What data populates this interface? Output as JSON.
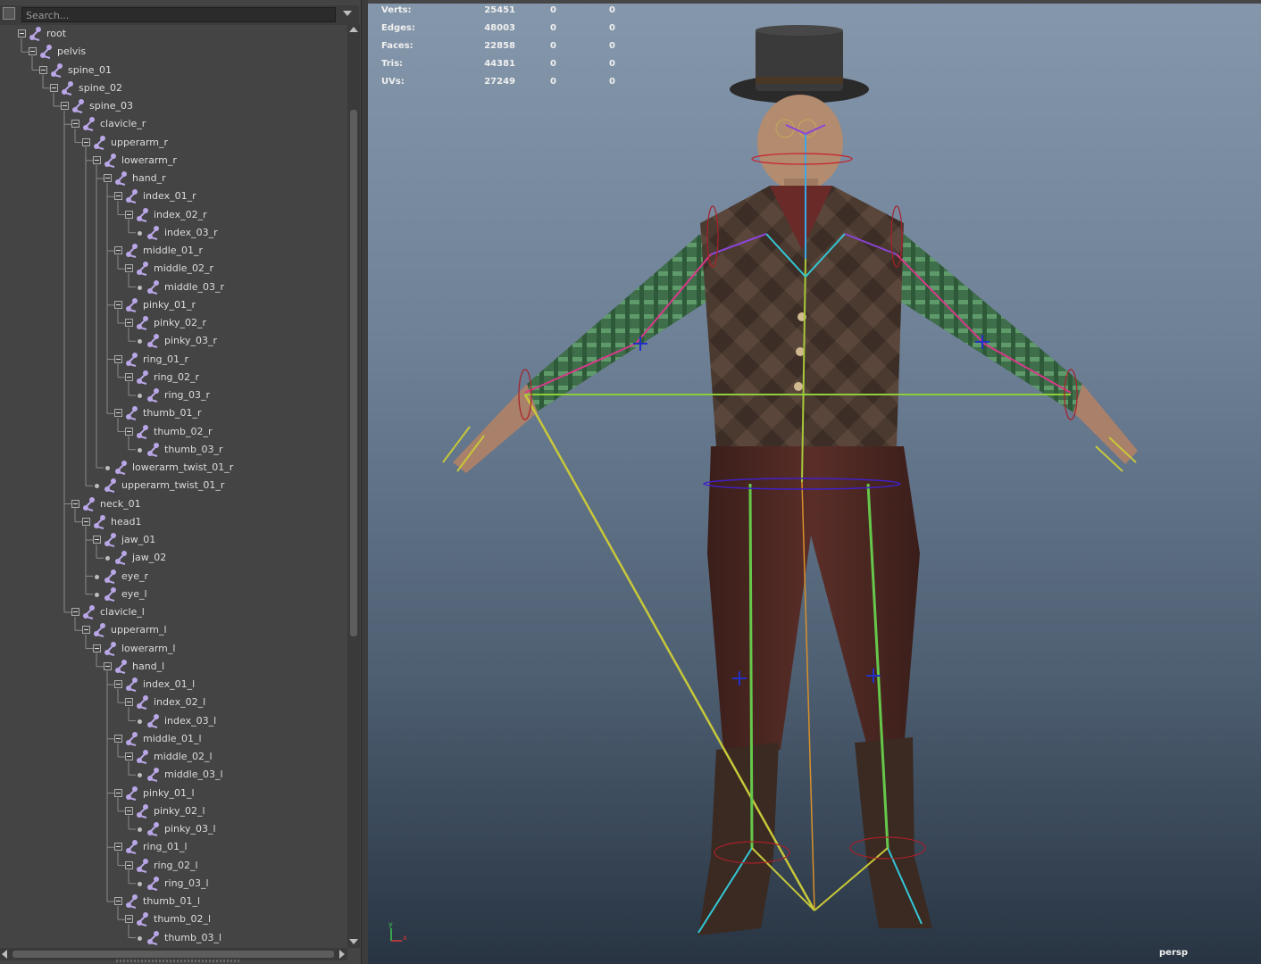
{
  "outliner": {
    "search": {
      "placeholder": "Search..."
    },
    "nodes": [
      {
        "label": "root",
        "depth": 0,
        "expandable": true
      },
      {
        "label": "pelvis",
        "depth": 1,
        "expandable": true
      },
      {
        "label": "spine_01",
        "depth": 2,
        "expandable": true
      },
      {
        "label": "spine_02",
        "depth": 3,
        "expandable": true
      },
      {
        "label": "spine_03",
        "depth": 4,
        "expandable": true
      },
      {
        "label": "clavicle_r",
        "depth": 5,
        "expandable": true
      },
      {
        "label": "upperarm_r",
        "depth": 6,
        "expandable": true
      },
      {
        "label": "lowerarm_r",
        "depth": 7,
        "expandable": true
      },
      {
        "label": "hand_r",
        "depth": 8,
        "expandable": true
      },
      {
        "label": "index_01_r",
        "depth": 9,
        "expandable": true
      },
      {
        "label": "index_02_r",
        "depth": 10,
        "expandable": true
      },
      {
        "label": "index_03_r",
        "depth": 11,
        "expandable": false
      },
      {
        "label": "middle_01_r",
        "depth": 9,
        "expandable": true
      },
      {
        "label": "middle_02_r",
        "depth": 10,
        "expandable": true
      },
      {
        "label": "middle_03_r",
        "depth": 11,
        "expandable": false
      },
      {
        "label": "pinky_01_r",
        "depth": 9,
        "expandable": true
      },
      {
        "label": "pinky_02_r",
        "depth": 10,
        "expandable": true
      },
      {
        "label": "pinky_03_r",
        "depth": 11,
        "expandable": false
      },
      {
        "label": "ring_01_r",
        "depth": 9,
        "expandable": true
      },
      {
        "label": "ring_02_r",
        "depth": 10,
        "expandable": true
      },
      {
        "label": "ring_03_r",
        "depth": 11,
        "expandable": false
      },
      {
        "label": "thumb_01_r",
        "depth": 9,
        "expandable": true
      },
      {
        "label": "thumb_02_r",
        "depth": 10,
        "expandable": true
      },
      {
        "label": "thumb_03_r",
        "depth": 11,
        "expandable": false
      },
      {
        "label": "lowerarm_twist_01_r",
        "depth": 8,
        "expandable": false
      },
      {
        "label": "upperarm_twist_01_r",
        "depth": 7,
        "expandable": false
      },
      {
        "label": "neck_01",
        "depth": 5,
        "expandable": true
      },
      {
        "label": "head1",
        "depth": 6,
        "expandable": true
      },
      {
        "label": "jaw_01",
        "depth": 7,
        "expandable": true
      },
      {
        "label": "jaw_02",
        "depth": 8,
        "expandable": false
      },
      {
        "label": "eye_r",
        "depth": 7,
        "expandable": false
      },
      {
        "label": "eye_l",
        "depth": 7,
        "expandable": false
      },
      {
        "label": "clavicle_l",
        "depth": 5,
        "expandable": true
      },
      {
        "label": "upperarm_l",
        "depth": 6,
        "expandable": true
      },
      {
        "label": "lowerarm_l",
        "depth": 7,
        "expandable": true
      },
      {
        "label": "hand_l",
        "depth": 8,
        "expandable": true
      },
      {
        "label": "index_01_l",
        "depth": 9,
        "expandable": true
      },
      {
        "label": "index_02_l",
        "depth": 10,
        "expandable": true
      },
      {
        "label": "index_03_l",
        "depth": 11,
        "expandable": false
      },
      {
        "label": "middle_01_l",
        "depth": 9,
        "expandable": true
      },
      {
        "label": "middle_02_l",
        "depth": 10,
        "expandable": true
      },
      {
        "label": "middle_03_l",
        "depth": 11,
        "expandable": false
      },
      {
        "label": "pinky_01_l",
        "depth": 9,
        "expandable": true
      },
      {
        "label": "pinky_02_l",
        "depth": 10,
        "expandable": true
      },
      {
        "label": "pinky_03_l",
        "depth": 11,
        "expandable": false
      },
      {
        "label": "ring_01_l",
        "depth": 9,
        "expandable": true
      },
      {
        "label": "ring_02_l",
        "depth": 10,
        "expandable": true
      },
      {
        "label": "ring_03_l",
        "depth": 11,
        "expandable": false
      },
      {
        "label": "thumb_01_l",
        "depth": 9,
        "expandable": true
      },
      {
        "label": "thumb_02_l",
        "depth": 10,
        "expandable": true
      },
      {
        "label": "thumb_03_l",
        "depth": 11,
        "expandable": false
      }
    ]
  },
  "viewport": {
    "hud": [
      {
        "label": "Verts:",
        "values": [
          "25451",
          "0",
          "0"
        ]
      },
      {
        "label": "Edges:",
        "values": [
          "48003",
          "0",
          "0"
        ]
      },
      {
        "label": "Faces:",
        "values": [
          "22858",
          "0",
          "0"
        ]
      },
      {
        "label": "Tris:",
        "values": [
          "44381",
          "0",
          "0"
        ]
      },
      {
        "label": "UVs:",
        "values": [
          "27249",
          "0",
          "0"
        ]
      }
    ],
    "camera": "persp",
    "axis": {
      "y": "y",
      "x": "x"
    }
  },
  "colors": {
    "outliner_bg": "#444444",
    "joint_icon": "#b9a6e6",
    "viewport_top": "#8597ab",
    "viewport_bottom": "#283442"
  },
  "icons": {
    "joint": "joint-icon",
    "collapse": "collapse-toggle-icon",
    "filter": "filter-icon"
  }
}
